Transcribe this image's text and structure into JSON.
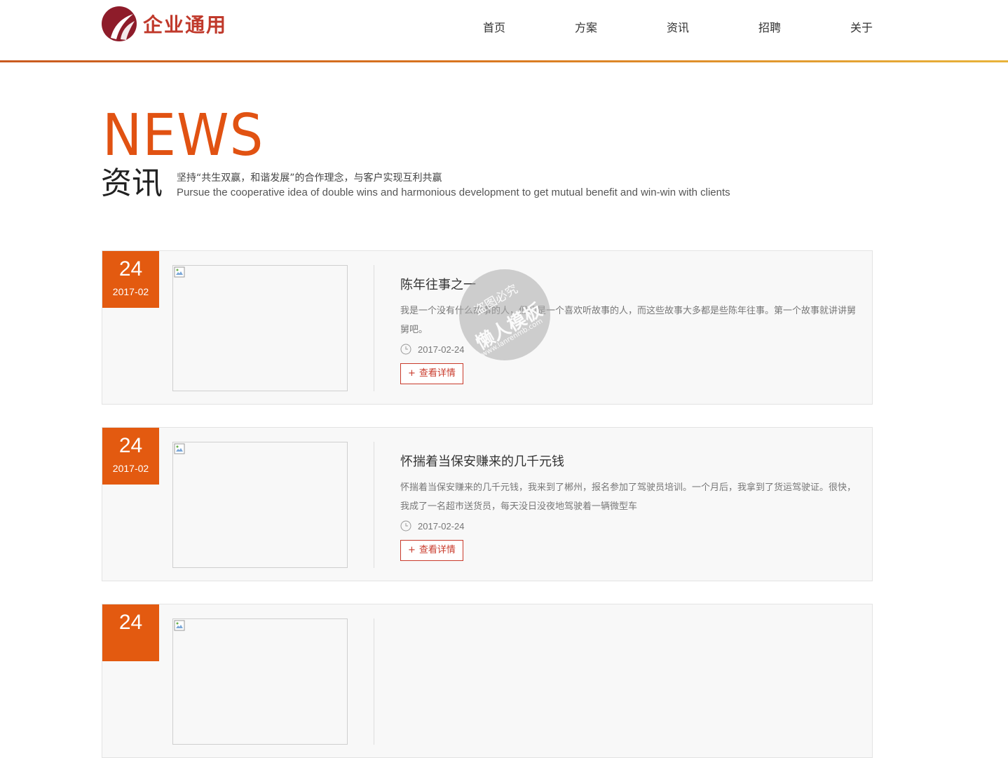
{
  "brand": {
    "logo_text": "企业通用",
    "logo_color": "#c0392b"
  },
  "nav": {
    "items": [
      "首页",
      "方案",
      "资讯",
      "招聘",
      "关于"
    ]
  },
  "hero": {
    "title_en": "NEWS",
    "title_cn": "资讯",
    "subtitle_cn": "坚持“共生双赢，和谐发展”的合作理念，与客户实现互利共赢",
    "subtitle_en": "Pursue the cooperative idea of double wins and harmonious development to get mutual benefit and win-win with clients",
    "accent_color": "#e15212"
  },
  "news": [
    {
      "day": "24",
      "year_month": "2017-02",
      "title": "陈年往事之一",
      "summary": "我是一个没有什么故事的人，但我是一个喜欢听故事的人，而这些故事大多都是些陈年往事。第一个故事就讲讲舅舅吧。",
      "date": "2017-02-24",
      "more_label": "查看详情"
    },
    {
      "day": "24",
      "year_month": "2017-02",
      "title": "怀揣着当保安赚来的几千元钱",
      "summary": "怀揣着当保安赚来的几千元钱，我来到了郴州，报名参加了驾驶员培训。一个月后，我拿到了货运驾驶证。很快，我成了一名超市送货员，每天没日没夜地驾驶着一辆微型车",
      "date": "2017-02-24",
      "more_label": "查看详情"
    },
    {
      "day": "24",
      "year_month": "",
      "title": "",
      "summary": "",
      "date": "",
      "more_label": ""
    }
  ],
  "icons": {
    "clock": "clock-icon",
    "broken_image": "broken-image-icon",
    "plus": "+"
  },
  "watermark": {
    "line1": "盗图必究",
    "line2": "懒人模板",
    "line3": "www.lanrenmb.com"
  }
}
